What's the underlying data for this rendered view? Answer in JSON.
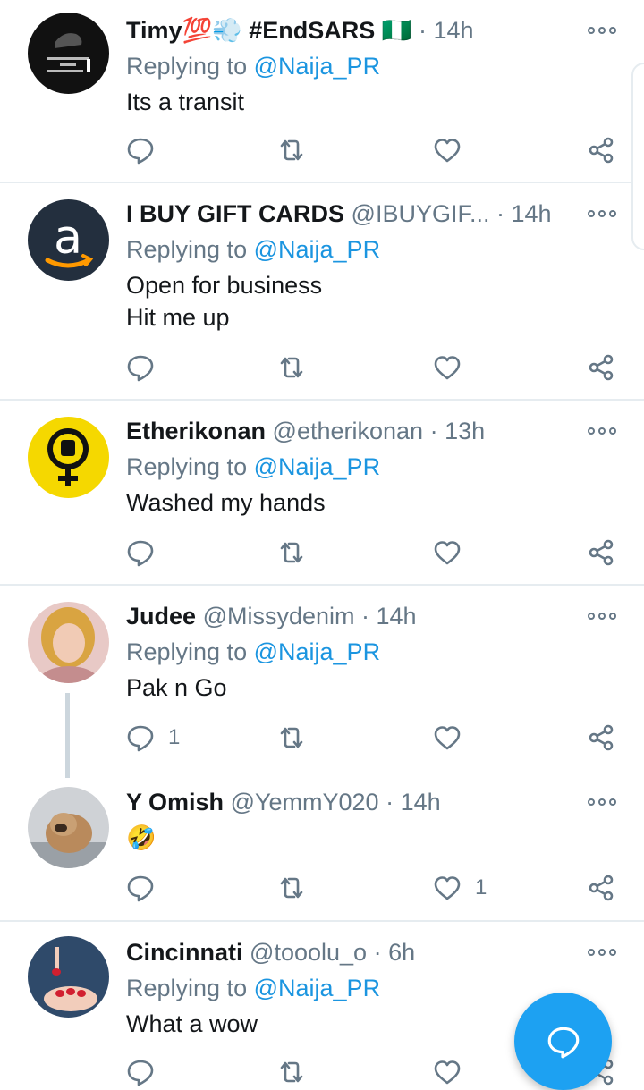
{
  "colors": {
    "accent": "#1da1f2",
    "link": "#1b95e0",
    "muted": "#657786",
    "text": "#14171a",
    "divider": "#e6ecf0"
  },
  "reply_prefix": "Replying to",
  "tweets": [
    {
      "name": "Timy💯💨 #EndSARS 🇳🇬",
      "handle": "",
      "time": "14h",
      "reply_to": "@Naija_PR",
      "text": [
        "Its a transit"
      ],
      "avatar": "enough-is-enough",
      "reply_count": "",
      "like_count": ""
    },
    {
      "name": "I BUY GIFT CARDS",
      "handle": "@IBUYGIF...",
      "time": "14h",
      "reply_to": "@Naija_PR",
      "text": [
        "Open for business",
        "Hit me up"
      ],
      "avatar": "amazon-logo",
      "reply_count": "",
      "like_count": ""
    },
    {
      "name": "Etherikonan",
      "handle": "@etherikonan",
      "time": "13h",
      "reply_to": "@Naija_PR",
      "text": [
        "Washed my hands"
      ],
      "avatar": "feminist-fist",
      "reply_count": "",
      "like_count": ""
    },
    {
      "name": "Judee",
      "handle": "@Missydenim",
      "time": "14h",
      "reply_to": "@Naija_PR",
      "text": [
        "Pak n Go"
      ],
      "avatar": "woman-portrait",
      "reply_count": "1",
      "like_count": ""
    },
    {
      "name": "Y Omish",
      "handle": "@YemmY020",
      "time": "14h",
      "reply_to": "",
      "text": [
        "🤣"
      ],
      "avatar": "bulldog-photo",
      "reply_count": "",
      "like_count": "1"
    },
    {
      "name": "Cincinnati",
      "handle": "@tooolu_o",
      "time": "6h",
      "reply_to": "@Naija_PR",
      "text": [
        "What a wow"
      ],
      "avatar": "painted-nails",
      "reply_count": "",
      "like_count": ""
    }
  ],
  "fab": {
    "icon": "compose-reply-icon"
  }
}
